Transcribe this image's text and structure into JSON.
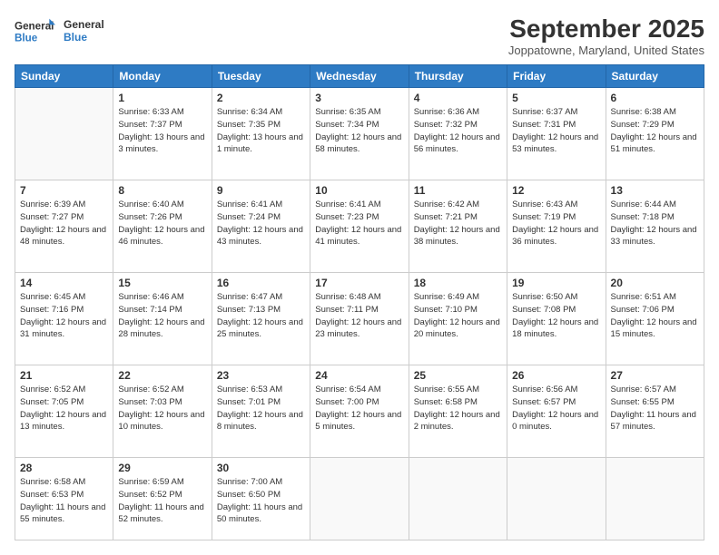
{
  "header": {
    "logo_line1": "General",
    "logo_line2": "Blue",
    "month": "September 2025",
    "location": "Joppatowne, Maryland, United States"
  },
  "weekdays": [
    "Sunday",
    "Monday",
    "Tuesday",
    "Wednesday",
    "Thursday",
    "Friday",
    "Saturday"
  ],
  "weeks": [
    [
      {
        "day": "",
        "sunrise": "",
        "sunset": "",
        "daylight": ""
      },
      {
        "day": "1",
        "sunrise": "Sunrise: 6:33 AM",
        "sunset": "Sunset: 7:37 PM",
        "daylight": "Daylight: 13 hours and 3 minutes."
      },
      {
        "day": "2",
        "sunrise": "Sunrise: 6:34 AM",
        "sunset": "Sunset: 7:35 PM",
        "daylight": "Daylight: 13 hours and 1 minute."
      },
      {
        "day": "3",
        "sunrise": "Sunrise: 6:35 AM",
        "sunset": "Sunset: 7:34 PM",
        "daylight": "Daylight: 12 hours and 58 minutes."
      },
      {
        "day": "4",
        "sunrise": "Sunrise: 6:36 AM",
        "sunset": "Sunset: 7:32 PM",
        "daylight": "Daylight: 12 hours and 56 minutes."
      },
      {
        "day": "5",
        "sunrise": "Sunrise: 6:37 AM",
        "sunset": "Sunset: 7:31 PM",
        "daylight": "Daylight: 12 hours and 53 minutes."
      },
      {
        "day": "6",
        "sunrise": "Sunrise: 6:38 AM",
        "sunset": "Sunset: 7:29 PM",
        "daylight": "Daylight: 12 hours and 51 minutes."
      }
    ],
    [
      {
        "day": "7",
        "sunrise": "Sunrise: 6:39 AM",
        "sunset": "Sunset: 7:27 PM",
        "daylight": "Daylight: 12 hours and 48 minutes."
      },
      {
        "day": "8",
        "sunrise": "Sunrise: 6:40 AM",
        "sunset": "Sunset: 7:26 PM",
        "daylight": "Daylight: 12 hours and 46 minutes."
      },
      {
        "day": "9",
        "sunrise": "Sunrise: 6:41 AM",
        "sunset": "Sunset: 7:24 PM",
        "daylight": "Daylight: 12 hours and 43 minutes."
      },
      {
        "day": "10",
        "sunrise": "Sunrise: 6:41 AM",
        "sunset": "Sunset: 7:23 PM",
        "daylight": "Daylight: 12 hours and 41 minutes."
      },
      {
        "day": "11",
        "sunrise": "Sunrise: 6:42 AM",
        "sunset": "Sunset: 7:21 PM",
        "daylight": "Daylight: 12 hours and 38 minutes."
      },
      {
        "day": "12",
        "sunrise": "Sunrise: 6:43 AM",
        "sunset": "Sunset: 7:19 PM",
        "daylight": "Daylight: 12 hours and 36 minutes."
      },
      {
        "day": "13",
        "sunrise": "Sunrise: 6:44 AM",
        "sunset": "Sunset: 7:18 PM",
        "daylight": "Daylight: 12 hours and 33 minutes."
      }
    ],
    [
      {
        "day": "14",
        "sunrise": "Sunrise: 6:45 AM",
        "sunset": "Sunset: 7:16 PM",
        "daylight": "Daylight: 12 hours and 31 minutes."
      },
      {
        "day": "15",
        "sunrise": "Sunrise: 6:46 AM",
        "sunset": "Sunset: 7:14 PM",
        "daylight": "Daylight: 12 hours and 28 minutes."
      },
      {
        "day": "16",
        "sunrise": "Sunrise: 6:47 AM",
        "sunset": "Sunset: 7:13 PM",
        "daylight": "Daylight: 12 hours and 25 minutes."
      },
      {
        "day": "17",
        "sunrise": "Sunrise: 6:48 AM",
        "sunset": "Sunset: 7:11 PM",
        "daylight": "Daylight: 12 hours and 23 minutes."
      },
      {
        "day": "18",
        "sunrise": "Sunrise: 6:49 AM",
        "sunset": "Sunset: 7:10 PM",
        "daylight": "Daylight: 12 hours and 20 minutes."
      },
      {
        "day": "19",
        "sunrise": "Sunrise: 6:50 AM",
        "sunset": "Sunset: 7:08 PM",
        "daylight": "Daylight: 12 hours and 18 minutes."
      },
      {
        "day": "20",
        "sunrise": "Sunrise: 6:51 AM",
        "sunset": "Sunset: 7:06 PM",
        "daylight": "Daylight: 12 hours and 15 minutes."
      }
    ],
    [
      {
        "day": "21",
        "sunrise": "Sunrise: 6:52 AM",
        "sunset": "Sunset: 7:05 PM",
        "daylight": "Daylight: 12 hours and 13 minutes."
      },
      {
        "day": "22",
        "sunrise": "Sunrise: 6:52 AM",
        "sunset": "Sunset: 7:03 PM",
        "daylight": "Daylight: 12 hours and 10 minutes."
      },
      {
        "day": "23",
        "sunrise": "Sunrise: 6:53 AM",
        "sunset": "Sunset: 7:01 PM",
        "daylight": "Daylight: 12 hours and 8 minutes."
      },
      {
        "day": "24",
        "sunrise": "Sunrise: 6:54 AM",
        "sunset": "Sunset: 7:00 PM",
        "daylight": "Daylight: 12 hours and 5 minutes."
      },
      {
        "day": "25",
        "sunrise": "Sunrise: 6:55 AM",
        "sunset": "Sunset: 6:58 PM",
        "daylight": "Daylight: 12 hours and 2 minutes."
      },
      {
        "day": "26",
        "sunrise": "Sunrise: 6:56 AM",
        "sunset": "Sunset: 6:57 PM",
        "daylight": "Daylight: 12 hours and 0 minutes."
      },
      {
        "day": "27",
        "sunrise": "Sunrise: 6:57 AM",
        "sunset": "Sunset: 6:55 PM",
        "daylight": "Daylight: 11 hours and 57 minutes."
      }
    ],
    [
      {
        "day": "28",
        "sunrise": "Sunrise: 6:58 AM",
        "sunset": "Sunset: 6:53 PM",
        "daylight": "Daylight: 11 hours and 55 minutes."
      },
      {
        "day": "29",
        "sunrise": "Sunrise: 6:59 AM",
        "sunset": "Sunset: 6:52 PM",
        "daylight": "Daylight: 11 hours and 52 minutes."
      },
      {
        "day": "30",
        "sunrise": "Sunrise: 7:00 AM",
        "sunset": "Sunset: 6:50 PM",
        "daylight": "Daylight: 11 hours and 50 minutes."
      },
      {
        "day": "",
        "sunrise": "",
        "sunset": "",
        "daylight": ""
      },
      {
        "day": "",
        "sunrise": "",
        "sunset": "",
        "daylight": ""
      },
      {
        "day": "",
        "sunrise": "",
        "sunset": "",
        "daylight": ""
      },
      {
        "day": "",
        "sunrise": "",
        "sunset": "",
        "daylight": ""
      }
    ]
  ]
}
